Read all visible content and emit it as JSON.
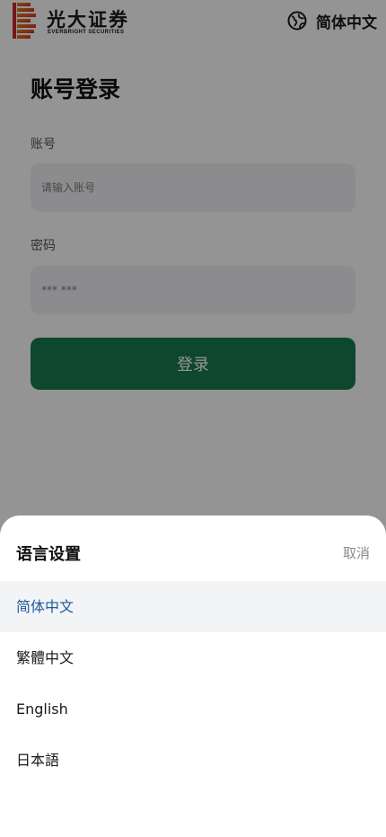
{
  "header": {
    "brand_name": "光大证券",
    "brand_sub": "EVERBRIGHT SECURITIES",
    "language_current": "简体中文",
    "globe_icon": "globe-icon",
    "logo_icon": "everbright-logo"
  },
  "login": {
    "title": "账号登录",
    "account_label": "账号",
    "account_placeholder": "请输入账号",
    "password_label": "密码",
    "password_placeholder": "*** ***",
    "submit_label": "登录"
  },
  "language_sheet": {
    "title": "语言设置",
    "cancel_label": "取消",
    "selected_index": 0,
    "options": [
      {
        "label": "简体中文"
      },
      {
        "label": "繁體中文"
      },
      {
        "label": "English"
      },
      {
        "label": "日本語"
      }
    ]
  },
  "colors": {
    "primary_button": "#187a4f",
    "selected_text": "#1d5a9a",
    "logo_red": "#c8292c",
    "logo_orange": "#e88a1f"
  }
}
